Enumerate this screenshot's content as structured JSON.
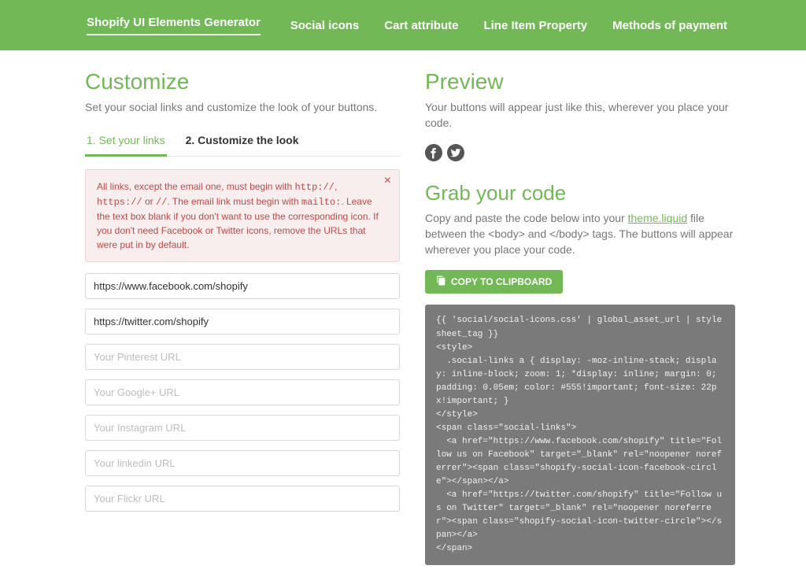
{
  "header": {
    "brand": "Shopify UI Elements Generator",
    "nav": {
      "social": "Social icons",
      "cart": "Cart attribute",
      "lineitem": "Line Item Property",
      "payment": "Methods of payment"
    }
  },
  "customize": {
    "title": "Customize",
    "lead": "Set your social links and customize the look of your buttons.",
    "tabs": {
      "links": "1. Set your links",
      "look": "2. Customize the look"
    },
    "alert_part1": "All links, except the email one, must begin with ",
    "alert_code1": "http://",
    "alert_sep1": ", ",
    "alert_code2": "https://",
    "alert_sep2": " or ",
    "alert_code3": "//",
    "alert_part2": ". The email link must begin with ",
    "alert_code4": "mailto:",
    "alert_part3": ". Leave the text box blank if you don't want to use the corresponding icon. If you don't need Facebook or Twitter icons, remove the URLs that were put in by default.",
    "alert_close": "×",
    "inputs": {
      "facebook_value": "https://www.facebook.com/shopify",
      "twitter_value": "https://twitter.com/shopify",
      "pinterest_ph": "Your Pinterest URL",
      "google_ph": "Your Google+ URL",
      "instagram_ph": "Your Instagram URL",
      "linkedin_ph": "Your linkedin URL",
      "flickr_ph": "Your Flickr URL"
    }
  },
  "preview": {
    "title": "Preview",
    "lead": "Your buttons will appear just like this, wherever you place your code."
  },
  "grab": {
    "title": "Grab your code",
    "lead_before": "Copy and paste the code below into your ",
    "lead_link": "theme.liquid",
    "lead_after": " file between the <body> and </body> tags. The buttons will appear wherever you place your code.",
    "copy_btn": "COPY TO CLIPBOARD",
    "code": "{{ 'social/social-icons.css' | global_asset_url | stylesheet_tag }}\n<style>\n  .social-links a { display: -moz-inline-stack; display: inline-block; zoom: 1; *display: inline; margin: 0; padding: 0.05em; color: #555!important; font-size: 22px!important; }\n</style>\n<span class=\"social-links\">\n  <a href=\"https://www.facebook.com/shopify\" title=\"Follow us on Facebook\" target=\"_blank\" rel=\"noopener noreferrer\"><span class=\"shopify-social-icon-facebook-circle\"></span></a>\n  <a href=\"https://twitter.com/shopify\" title=\"Follow us on Twitter\" target=\"_blank\" rel=\"noopener noreferrer\"><span class=\"shopify-social-icon-twitter-circle\"></span></a>\n</span>"
  }
}
